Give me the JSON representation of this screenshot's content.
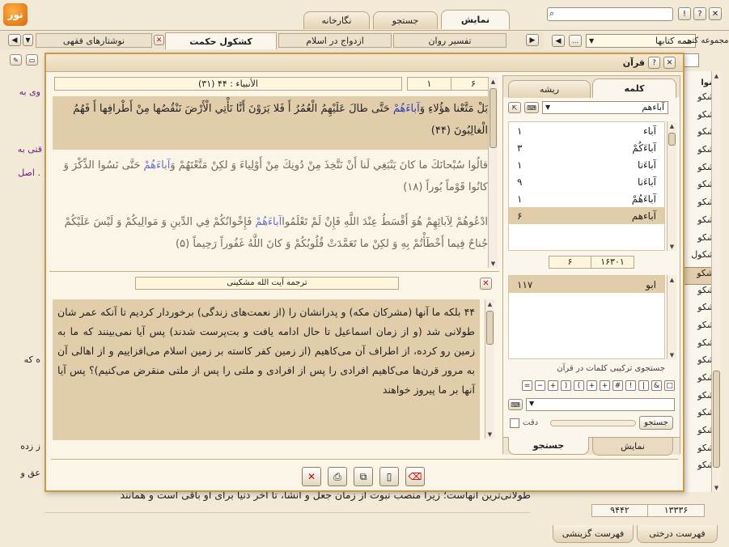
{
  "app": {
    "logo": "نور"
  },
  "window_buttons": [
    "close-icon",
    "help-icon",
    "alert-icon"
  ],
  "main_tabs": [
    {
      "label": "نمایش"
    },
    {
      "label": "جستجو"
    },
    {
      "label": "نگارخانه"
    }
  ],
  "doc_tabs": [
    {
      "label": "نوشتارهای فقهی"
    },
    {
      "label": "کشکول حکمت"
    },
    {
      "label": "ازدواج در اسلام"
    },
    {
      "label": "تفسیر روان"
    }
  ],
  "left_panel": {
    "collection_label": "مجموعه کتب",
    "collection_value": "همه کتابها",
    "heading_partial": "عنوا",
    "items": [
      "کشکو",
      "کشکو",
      "کشکو",
      "کشکو",
      "کشکو",
      "کشکو",
      "کشکو",
      "کشکو",
      "کشکو",
      "کشکول",
      "کشکو",
      "کشکو",
      "کشکو",
      "کشکو",
      "کشکو",
      "کشکو",
      "کشکو",
      "کشکو",
      "کشکو",
      "کشکو",
      "کشکو",
      "کشکو"
    ],
    "counter_a": "۱۳۳۳۶",
    "counter_b": "۹۴۴۲",
    "tabs": [
      "فهرست درختی",
      "فهرست گزینشی"
    ]
  },
  "background_text": {
    "l1": "وی به",
    "l2": "قتی به",
    "l3": ". اصل",
    "l4": "ه که",
    "l5": "ز زده",
    "l6": "عق و",
    "bottom_line": "طولانی‌ترین آنهاست؛ زیرا منصب نبوت از زمان جعل و انشا، تا آخر دنیا برای او باقی است و همانند"
  },
  "dialog": {
    "title": "قرآن",
    "verse_info": {
      "sura": "(۳۱) الأنبیاء : ۴۴",
      "page_a": "۱",
      "page_b": "۶"
    },
    "verses": [
      {
        "text": "بَلْ مَتَّعْنا هؤُلاءِ وَ",
        "hl": "آباءَهُمْ",
        "rest": " حَتَّى طالَ عَلَيْهِمُ الْعُمُرُ أَ فَلا يَرَوْنَ أَنَّا نَأْتِي الْأَرْضَ نَنْقُصُها مِنْ أَطْرافِها أَ فَهُمُ الْغالِبُونَ (۴۴)"
      },
      {
        "text": "قالُوا سُبْحانَكَ ما كانَ يَنْبَغِي لَنا أَنْ نَتَّخِذَ مِنْ دُونِكَ مِنْ أَوْلِياءَ وَ لكِنْ مَتَّعْتَهُمْ وَ",
        "hl": "آباءَهُمْ",
        "rest": " حَتَّى نَسُوا الذِّكْرَ وَ كانُوا قَوْماً بُوراً (۱۸)"
      },
      {
        "text": "ادْعُوهُمْ لِآبائِهِمْ هُوَ أَقْسَطُ عِنْدَ اللَّهِ فَإِنْ لَمْ تَعْلَمُوا",
        "hl": "آباءَهُمْ",
        "rest": " فَإِخْوانُكُمْ فِي الدِّينِ وَ مَوالِيكُمْ وَ لَيْسَ عَلَيْكُمْ جُناحٌ فِيما أَخْطَأْتُمْ بِهِ وَ لكِنْ ما تَعَمَّدَتْ قُلُوبُكُمْ وَ كانَ اللَّهُ غَفُوراً رَحِيماً (۵)"
      }
    ],
    "translation_label": "ترجمه آیت الله مشکینی",
    "translation": "۴۴ بلکه ما آنها (مشرکان مکه) و پدرانشان را (از نعمت‌های زندگی) برخوردار کردیم تا آنکه عمر شان طولانی شد (و از زمان اسماعیل تا حال ادامه یافت و بت‌پرست شدند) پس آیا نمی‌بینند که ما به زمین رو کرده، از اطراف آن می‌کاهیم (از زمین کفر کاسته بر زمین اسلام می‌افزاییم و از اهالی آن به مرور قرن‌ها می‌کاهیم افرادی را پس از افرادی و ملتی را پس از ملتی منقرض می‌کنیم)؟ پس آیا آنها بر ما پیروز خواهند",
    "right_tabs": [
      "کلمه",
      "ریشه"
    ],
    "search_word": "آباءهم",
    "words": [
      {
        "w": "آباء",
        "c": "۱"
      },
      {
        "w": "آباءَكُمْ",
        "c": "۳"
      },
      {
        "w": "آباءَنا",
        "c": "۱"
      },
      {
        "w": "آباءَنا",
        "c": "۹"
      },
      {
        "w": "آباءَهُمْ",
        "c": "۱"
      },
      {
        "w": "آباءهم",
        "c": "۶"
      }
    ],
    "nav": {
      "a": "۱۶۳۰۱",
      "b": "۶"
    },
    "roots": [
      {
        "w": "ابو",
        "c": "۱۱۷"
      }
    ],
    "combo_label": "جستجوی ترکیبی کلمات در قرآن",
    "symbols": [
      "□",
      "&",
      "|",
      "!",
      "#",
      "+",
      "+",
      "(",
      ")",
      "+",
      "−",
      "="
    ],
    "search_button": "جستجو",
    "exact_label": "دقت",
    "bottom_tabs": [
      "نمایش",
      "جستجو"
    ]
  }
}
